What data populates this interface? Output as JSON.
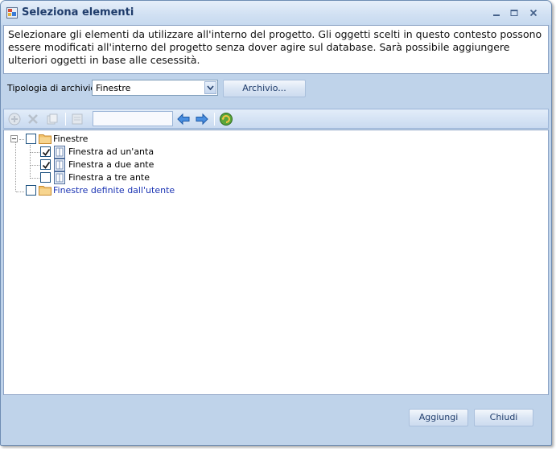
{
  "window": {
    "title": "Seleziona elementi"
  },
  "description": "Selezionare gli elementi da utilizzare all'interno del progetto. Gli oggetti scelti in questo contesto possono essere modificati all'interno del progetto senza dover agire sul database. Sarà possibile aggiungere ulteriori oggetti in base alle cesessità.",
  "archive": {
    "label": "Tipologia di archivio",
    "selected": "Finestre",
    "button": "Archivio..."
  },
  "toolbar": {
    "search_value": ""
  },
  "tree": {
    "root": {
      "label": "Finestre",
      "checked": false
    },
    "children": [
      {
        "label": "Finestra ad un'anta",
        "checked": true
      },
      {
        "label": "Finestra a due ante",
        "checked": true
      },
      {
        "label": "Finestra a tre ante",
        "checked": false
      }
    ],
    "user_folder": {
      "label": "Finestre definite dall'utente",
      "checked": false
    }
  },
  "footer": {
    "add": "Aggiungi",
    "close": "Chiudi"
  },
  "colors": {
    "accent": "#1f3c6b",
    "user_folder_text": "#1a33b3",
    "window_bg": "#bfd3ea"
  },
  "icons": [
    "app-icon",
    "minimize-icon",
    "maximize-icon",
    "close-icon",
    "chevron-down-icon",
    "add-icon",
    "delete-icon",
    "copy-icon",
    "properties-icon",
    "arrow-left-icon",
    "arrow-right-icon",
    "refresh-icon",
    "folder-icon",
    "document-icon"
  ]
}
